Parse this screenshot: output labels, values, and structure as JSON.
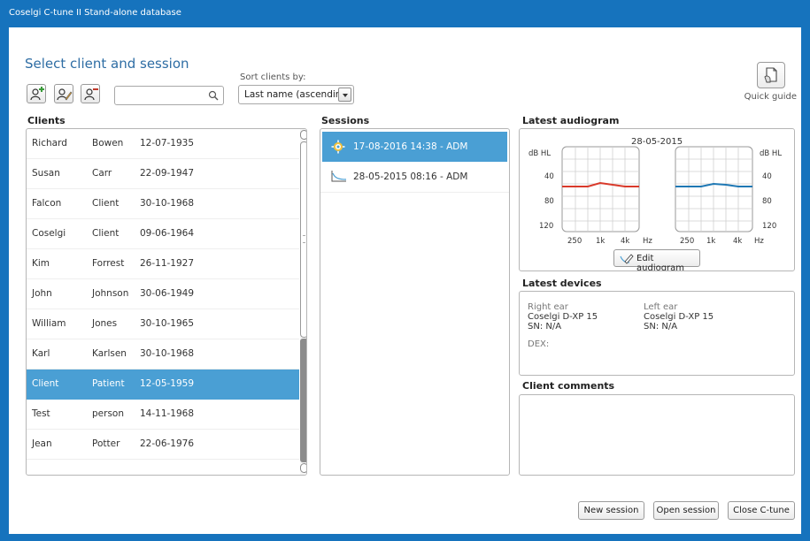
{
  "window": {
    "title": "Coselgi C-tune II Stand-alone database"
  },
  "page": {
    "heading": "Select client and session"
  },
  "toolbar": {
    "add_client_icon": "add-person-icon",
    "edit_client_icon": "edit-person-icon",
    "remove_client_icon": "remove-person-icon",
    "search_value": "",
    "search_icon": "magnifier-icon"
  },
  "sort": {
    "label": "Sort clients by:",
    "selected": "Last name (ascending)"
  },
  "quick_guide": {
    "label": "Quick guide",
    "icon": "document-hand-icon"
  },
  "clients": {
    "title": "Clients",
    "rows": [
      {
        "first": "Richard",
        "last": "Bowen",
        "dob": "12-07-1935"
      },
      {
        "first": "Susan",
        "last": "Carr",
        "dob": "22-09-1947"
      },
      {
        "first": "Falcon",
        "last": "Client",
        "dob": "30-10-1968"
      },
      {
        "first": "Coselgi",
        "last": "Client",
        "dob": "09-06-1964"
      },
      {
        "first": "Kim",
        "last": "Forrest",
        "dob": "26-11-1927"
      },
      {
        "first": "John",
        "last": "Johnson",
        "dob": "30-06-1949"
      },
      {
        "first": "William",
        "last": "Jones",
        "dob": "30-10-1965"
      },
      {
        "first": "Karl",
        "last": "Karlsen",
        "dob": "30-10-1968"
      },
      {
        "first": "Client",
        "last": "Patient",
        "dob": "12-05-1959",
        "selected": true
      },
      {
        "first": "Test",
        "last": "person",
        "dob": "14-11-1968"
      },
      {
        "first": "Jean",
        "last": "Potter",
        "dob": "22-06-1976"
      }
    ]
  },
  "sessions": {
    "title": "Sessions",
    "items": [
      {
        "label": "17-08-2016 14:38 - ADM",
        "icon": "gear-icon",
        "selected": true
      },
      {
        "label": "28-05-2015 08:16 - ADM",
        "icon": "audiogram-curve-icon",
        "selected": false
      }
    ]
  },
  "audiogram": {
    "title": "Latest audiogram",
    "date": "28-05-2015",
    "unit_left": "dB HL",
    "unit_right": "dB HL",
    "y_ticks": [
      "40",
      "80",
      "120"
    ],
    "x_ticks": [
      "250",
      "1k",
      "4k",
      "Hz"
    ],
    "right_ear_color": "#d93a2b",
    "left_ear_color": "#1f78b4",
    "edit_label": "Edit audiogram"
  },
  "devices": {
    "title": "Latest devices",
    "right_label": "Right ear",
    "right_model": "Coselgi D-XP 15",
    "right_sn": "SN: N/A",
    "left_label": "Left ear",
    "left_model": "Coselgi D-XP 15",
    "left_sn": "SN: N/A",
    "dex_label": "DEX:"
  },
  "comments": {
    "title": "Client comments",
    "text": ""
  },
  "buttons": {
    "new_session": "New session",
    "open_session": "Open session",
    "close": "Close C-tune"
  },
  "colors": {
    "accent": "#1673bd",
    "selection": "#4a9fd4"
  }
}
